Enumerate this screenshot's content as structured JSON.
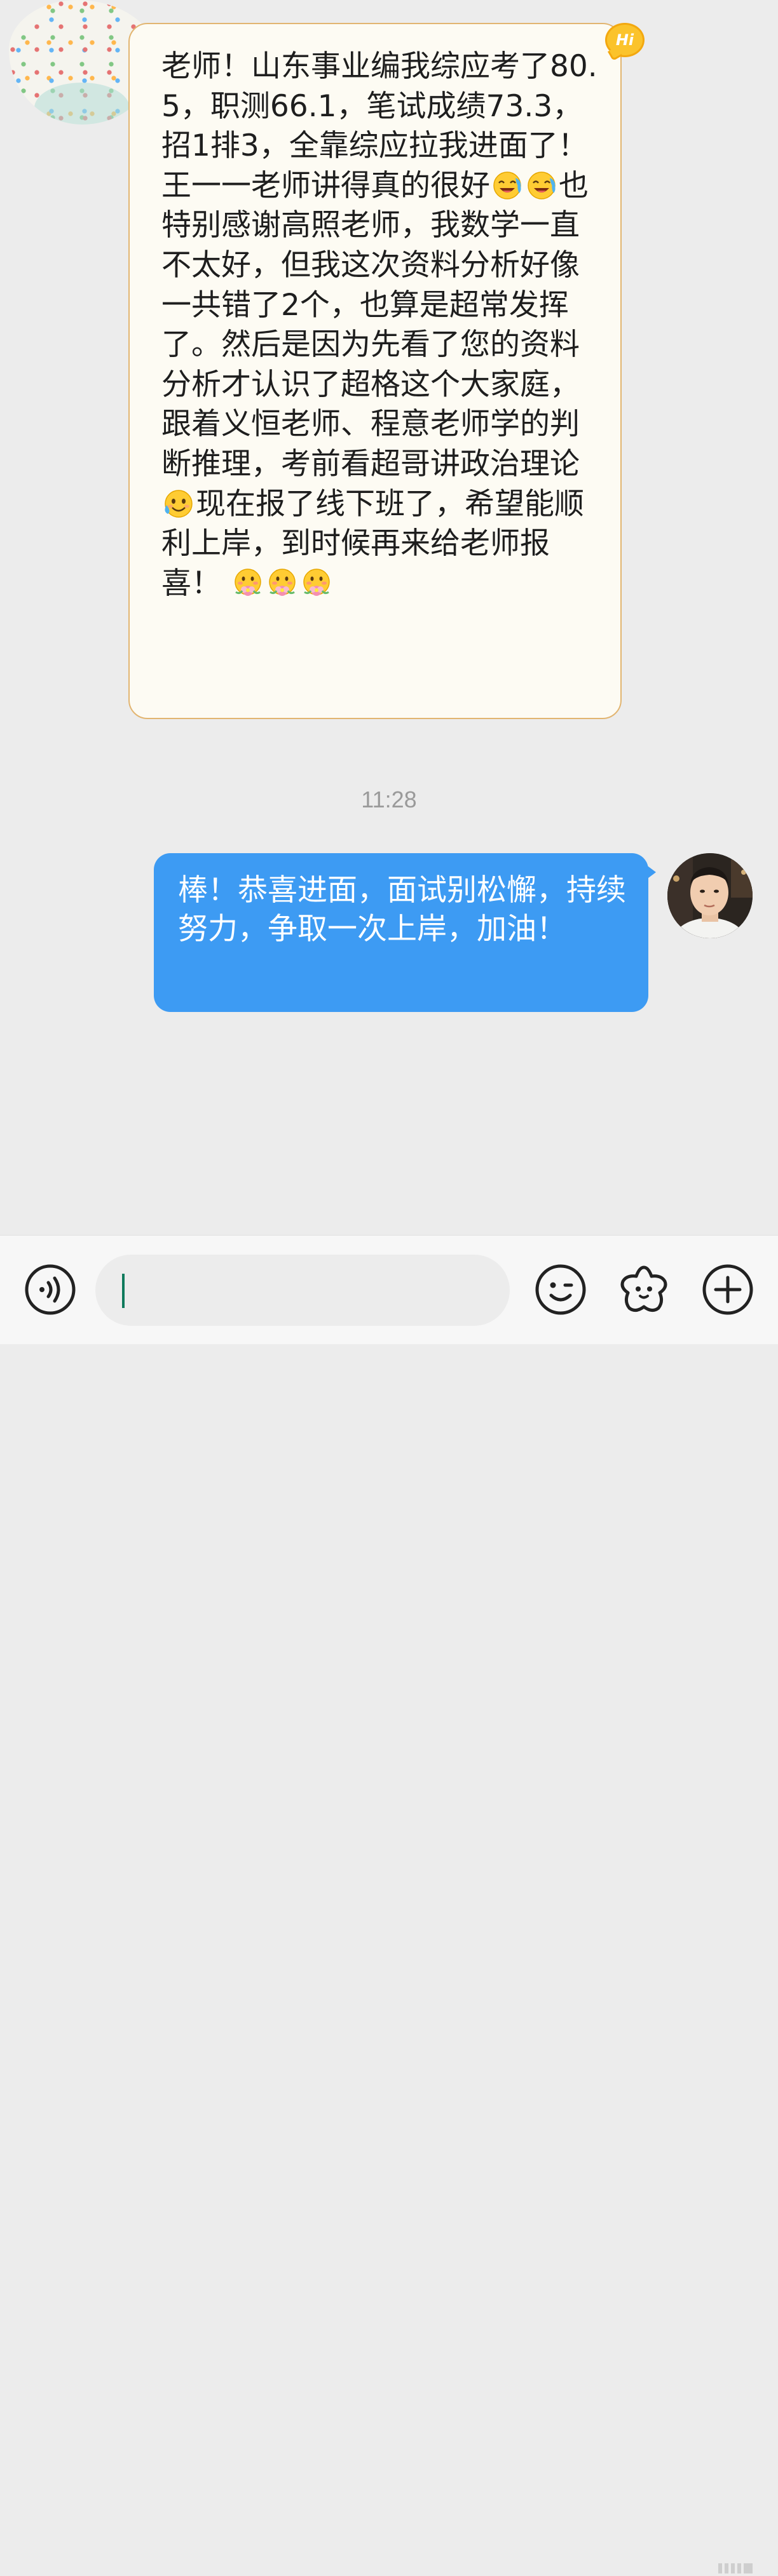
{
  "incoming": {
    "segments": [
      {
        "type": "text",
        "text": "老师！山东事业编我综应考了80.5，职测66.1，笔试成绩73.3，招1排3，全靠综应拉我进面了！王一一老师讲得真的很好"
      },
      {
        "type": "emoji",
        "name": "laugh-cry-emoji"
      },
      {
        "type": "emoji",
        "name": "laugh-cry-emoji"
      },
      {
        "type": "text",
        "text": "也特别感谢高照老师，我数学一直不太好，但我这次资料分析好像一共错了2个，也算是超常发挥了。然后是因为先看了您的资料分析才认识了超格这个大家庭，跟着义恒老师、程意老师学的判断推理，考前看超哥讲政治理论"
      },
      {
        "type": "emoji",
        "name": "sweat-smile-emoji"
      },
      {
        "type": "text",
        "text": "现在报了线下班了，希望能顺利上岸，到时候再来给老师报喜！ "
      },
      {
        "type": "emoji",
        "name": "flower-holding-emoji"
      },
      {
        "type": "emoji",
        "name": "flower-holding-emoji"
      },
      {
        "type": "emoji",
        "name": "flower-holding-emoji"
      }
    ],
    "badge": "Hi"
  },
  "timestamp": "11:28",
  "outgoing": {
    "text": "棒！恭喜进面，面试别松懈，持续努力，争取一次上岸，加油！"
  },
  "input_bar": {
    "placeholder": "",
    "icons": [
      "voice-icon",
      "emoji-icon",
      "sticker-icon",
      "plus-icon"
    ]
  },
  "colors": {
    "background": "#ececec",
    "incoming_bubble": "#fdfbf3",
    "incoming_border": "#e2b571",
    "outgoing_bubble": "#3d9bf3",
    "cursor": "#0f7a5c"
  }
}
